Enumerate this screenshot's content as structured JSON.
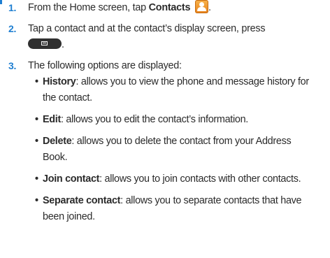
{
  "steps": [
    {
      "number": "1.",
      "text_before": "From the Home screen, tap ",
      "bold": "Contacts",
      "icon": "contacts-app-icon"
    },
    {
      "number": "2.",
      "line1": "Tap a contact and at the contact’s display screen, press",
      "key": "menu-key",
      "period": "."
    },
    {
      "number": "3.",
      "text": "The following options are displayed:"
    }
  ],
  "options": [
    {
      "term": "History",
      "line1": ": allows you to view the phone and message history for",
      "line2": "the contact."
    },
    {
      "term": "Edit",
      "line1": ": allows you to edit the contact’s information."
    },
    {
      "term": "Delete",
      "line1": ": allows you to delete the contact from your Address",
      "line2": "Book."
    },
    {
      "term": "Join contact",
      "line1": ": allows you to join contacts with other contacts."
    },
    {
      "term": "Separate contact",
      "line1": ": allows you to separate contacts that have",
      "line2": "been joined."
    }
  ],
  "colors": {
    "accent": "#1f7fd1",
    "text": "#2b2b2b",
    "icon_orange": "#ee9328",
    "key_dark": "#303030"
  }
}
